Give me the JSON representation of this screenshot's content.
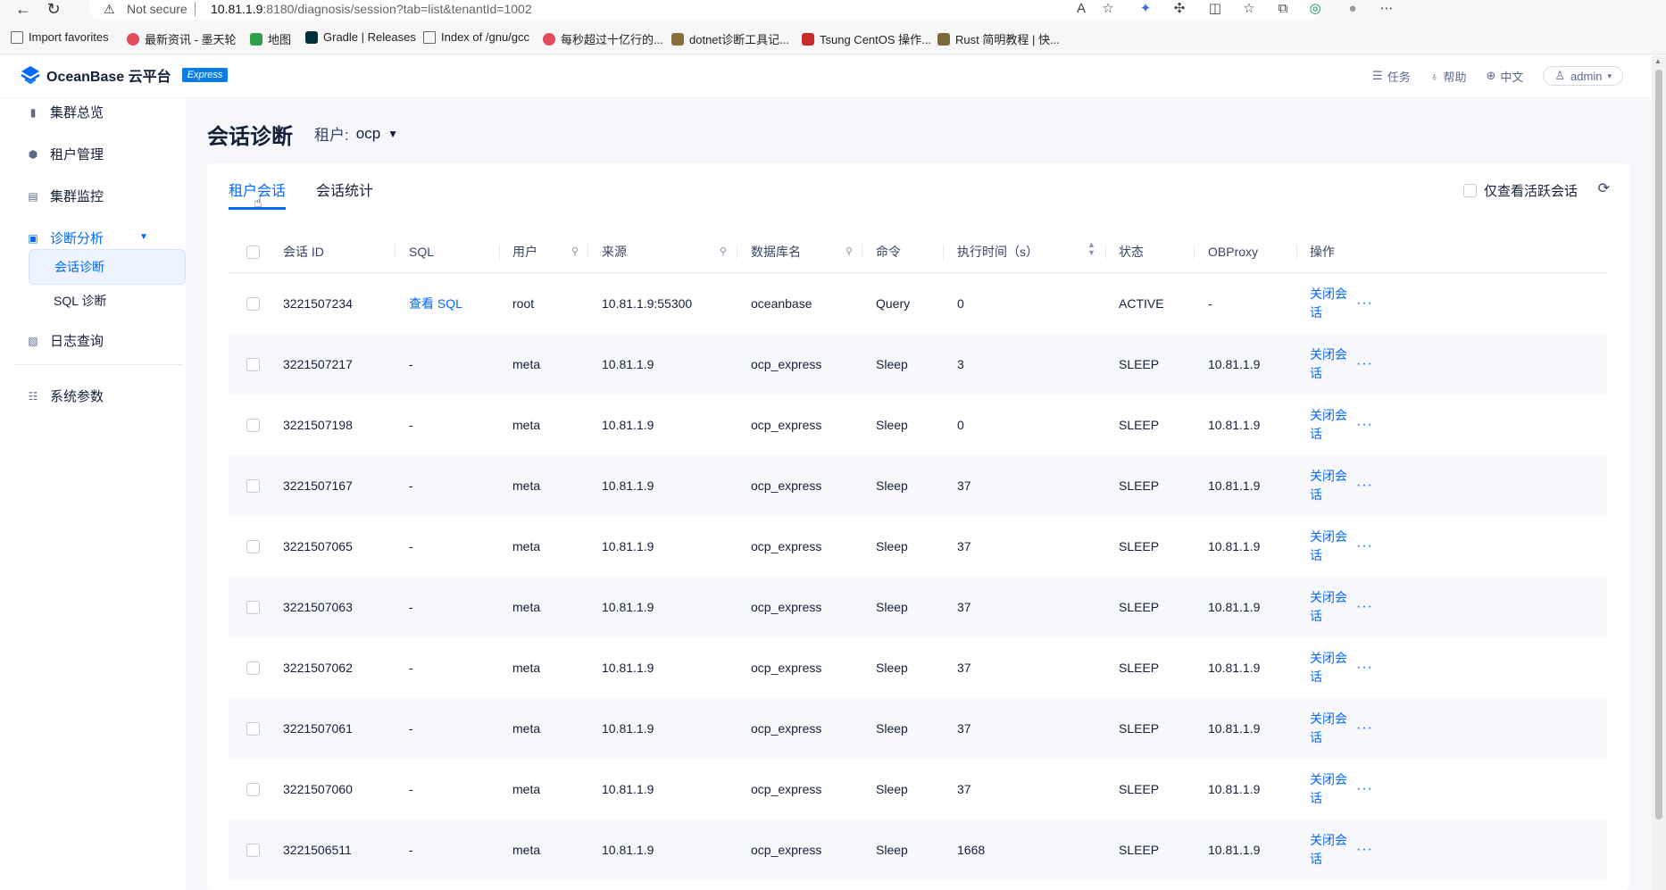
{
  "browser": {
    "url_warning": "Not secure",
    "url_host": "10.81.1.9",
    "url_path": ":8180/diagnosis/session?tab=list&tenantId=1002",
    "bookmarks": [
      "Import favorites",
      "最新资讯 - 墨天轮",
      "地图",
      "Gradle | Releases",
      "Index of /gnu/gcc",
      "每秒超过十亿行的...",
      "dotnet诊断工具记...",
      "Tsung CentOS 操作...",
      "Rust 简明教程 | 快..."
    ]
  },
  "header": {
    "brand": "OceanBase 云平台",
    "badge": "Express",
    "tasks": "任务",
    "help": "帮助",
    "language": "中文",
    "user": "admin"
  },
  "sidebar": {
    "cluster_overview": "集群总览",
    "tenant_mgmt": "租户管理",
    "cluster_monitor": "集群监控",
    "diagnosis": "诊断分析",
    "session_diagnosis": "会话诊断",
    "sql_diagnosis": "SQL 诊断",
    "log_query": "日志查询",
    "system_params": "系统参数"
  },
  "page": {
    "title": "会话诊断",
    "tenant_label": "租户:",
    "tenant_value": "ocp",
    "tabs": [
      "租户会话",
      "会话统计"
    ],
    "active_only": "仅查看活跃会话"
  },
  "table": {
    "columns": [
      "会话 ID",
      "SQL",
      "用户",
      "来源",
      "数据库名",
      "命令",
      "执行时间（s）",
      "状态",
      "OBProxy",
      "操作"
    ],
    "close_label": "关闭会话",
    "more_label": "···",
    "rows": [
      {
        "id": "3221507234",
        "sql": "查看 SQL",
        "user": "root",
        "source": "10.81.1.9:55300",
        "db": "oceanbase",
        "cmd": "Query",
        "time": "0",
        "state": "ACTIVE",
        "proxy": "-"
      },
      {
        "id": "3221507217",
        "sql": "-",
        "user": "meta",
        "source": "10.81.1.9",
        "db": "ocp_express",
        "cmd": "Sleep",
        "time": "3",
        "state": "SLEEP",
        "proxy": "10.81.1.9"
      },
      {
        "id": "3221507198",
        "sql": "-",
        "user": "meta",
        "source": "10.81.1.9",
        "db": "ocp_express",
        "cmd": "Sleep",
        "time": "0",
        "state": "SLEEP",
        "proxy": "10.81.1.9"
      },
      {
        "id": "3221507167",
        "sql": "-",
        "user": "meta",
        "source": "10.81.1.9",
        "db": "ocp_express",
        "cmd": "Sleep",
        "time": "37",
        "state": "SLEEP",
        "proxy": "10.81.1.9"
      },
      {
        "id": "3221507065",
        "sql": "-",
        "user": "meta",
        "source": "10.81.1.9",
        "db": "ocp_express",
        "cmd": "Sleep",
        "time": "37",
        "state": "SLEEP",
        "proxy": "10.81.1.9"
      },
      {
        "id": "3221507063",
        "sql": "-",
        "user": "meta",
        "source": "10.81.1.9",
        "db": "ocp_express",
        "cmd": "Sleep",
        "time": "37",
        "state": "SLEEP",
        "proxy": "10.81.1.9"
      },
      {
        "id": "3221507062",
        "sql": "-",
        "user": "meta",
        "source": "10.81.1.9",
        "db": "ocp_express",
        "cmd": "Sleep",
        "time": "37",
        "state": "SLEEP",
        "proxy": "10.81.1.9"
      },
      {
        "id": "3221507061",
        "sql": "-",
        "user": "meta",
        "source": "10.81.1.9",
        "db": "ocp_express",
        "cmd": "Sleep",
        "time": "37",
        "state": "SLEEP",
        "proxy": "10.81.1.9"
      },
      {
        "id": "3221507060",
        "sql": "-",
        "user": "meta",
        "source": "10.81.1.9",
        "db": "ocp_express",
        "cmd": "Sleep",
        "time": "37",
        "state": "SLEEP",
        "proxy": "10.81.1.9"
      },
      {
        "id": "3221506511",
        "sql": "-",
        "user": "meta",
        "source": "10.81.1.9",
        "db": "ocp_express",
        "cmd": "Sleep",
        "time": "1668",
        "state": "SLEEP",
        "proxy": "10.81.1.9"
      }
    ]
  },
  "colors": {
    "accent": "#006aff",
    "text": "#132039",
    "row_alt": "#f7f8fc"
  }
}
